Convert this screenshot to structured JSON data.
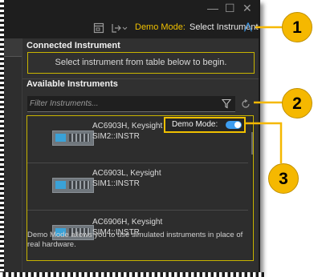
{
  "window": {
    "controls": {
      "minimize": "—",
      "maximize": "☐",
      "close": "✕"
    }
  },
  "toolbar": {
    "demo_mode_label": "Demo Mode:",
    "select_instrument_label": "Select Instrument",
    "chevron": "⋀"
  },
  "connected": {
    "title": "Connected Instrument",
    "hint": "Select instrument from table below to begin."
  },
  "available": {
    "title": "Available Instruments",
    "filter_placeholder": "Filter Instruments...",
    "more": "···",
    "instruments": [
      {
        "model": "AC6903H, Keysight",
        "address": "SIM2::INSTR"
      },
      {
        "model": "AC6903L, Keysight",
        "address": "SIM1::INSTR"
      },
      {
        "model": "AC6906H, Keysight",
        "address": "SIM4::INSTR"
      }
    ]
  },
  "popup": {
    "label": "Demo Mode:",
    "toggle_on": true
  },
  "note": "Demo Mode allows you to use simulated instruments in place of real hardware.",
  "callouts": [
    "1",
    "2",
    "3"
  ],
  "colors": {
    "accent": "#3d9df0",
    "highlight": "#f0c000",
    "callout": "#f5b800",
    "panel": "#303030"
  },
  "icons": [
    "window-icon",
    "connect-icon",
    "filter-icon",
    "refresh-icon",
    "more-icon",
    "chevron-up-icon"
  ]
}
